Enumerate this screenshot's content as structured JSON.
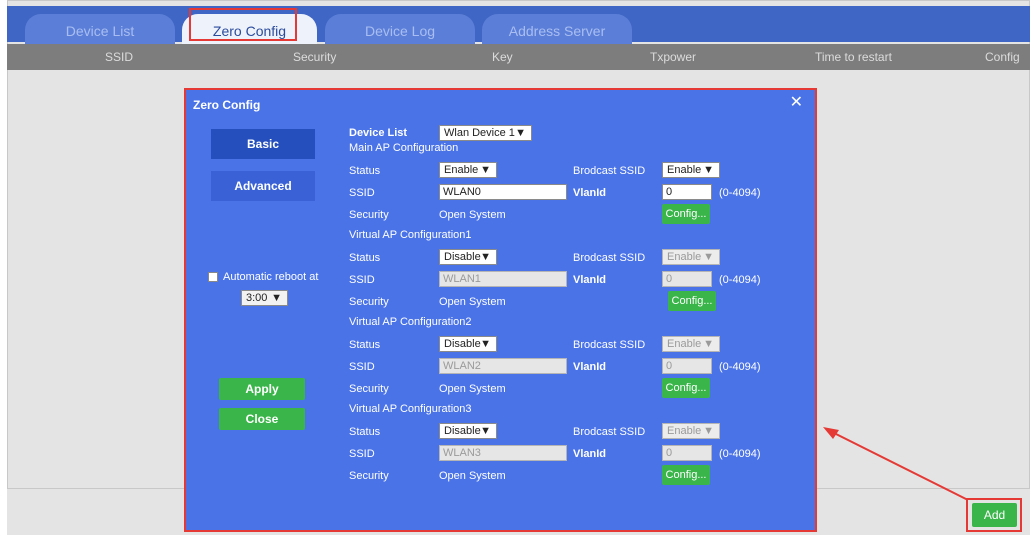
{
  "tabs": [
    "Device List",
    "Zero Config",
    "Device Log",
    "Address Server"
  ],
  "columns": [
    "SSID",
    "Security",
    "Key",
    "Txpower",
    "Time to restart",
    "Config"
  ],
  "footer": {
    "add_label": "Add"
  },
  "dialog": {
    "title": "Zero Config",
    "close_symbol": "✕",
    "left": {
      "basic": "Basic",
      "advanced": "Advanced",
      "reboot_label": "Automatic reboot at",
      "reboot_time": "3:00",
      "apply": "Apply",
      "close": "Close"
    },
    "device_list_label": "Device List",
    "device_list_value": "Wlan Device 1",
    "labels": {
      "status": "Status",
      "ssid": "SSID",
      "security": "Security",
      "brodcast": "Brodcast SSID",
      "vlanid": "VlanId",
      "range": "(0-4094)",
      "config": "Config..."
    },
    "sections": [
      {
        "title": "Main AP Configuration",
        "status": "Enable",
        "ssid": "WLAN0",
        "security": "Open System",
        "broadcast": "Enable",
        "vlan": "0"
      },
      {
        "title": "Virtual AP Configuration1",
        "status": "Disable",
        "ssid": "WLAN1",
        "security": "Open System",
        "broadcast": "Enable",
        "vlan": "0"
      },
      {
        "title": "Virtual AP Configuration2",
        "status": "Disable",
        "ssid": "WLAN2",
        "security": "Open System",
        "broadcast": "Enable",
        "vlan": "0"
      },
      {
        "title": "Virtual AP Configuration3",
        "status": "Disable",
        "ssid": "WLAN3",
        "security": "Open System",
        "broadcast": "Enable",
        "vlan": "0"
      }
    ]
  }
}
